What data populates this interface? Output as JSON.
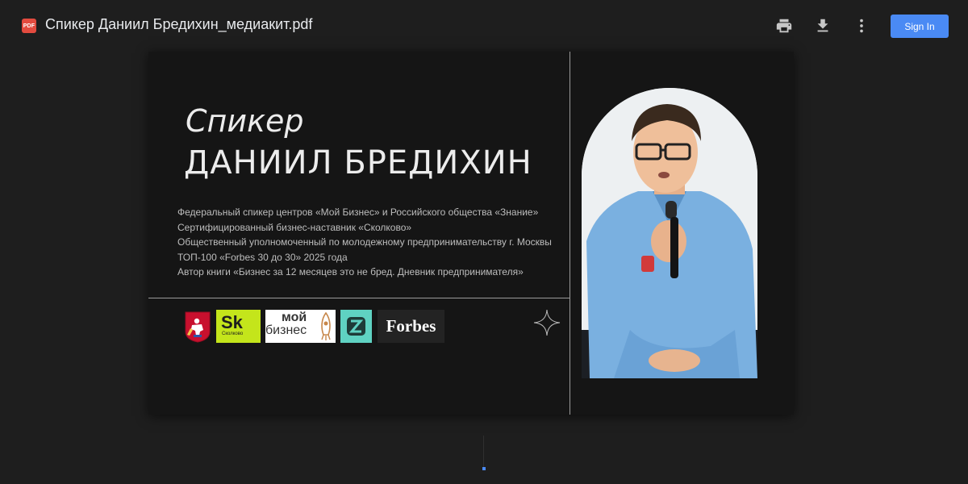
{
  "window": {
    "file_badge": "PDF",
    "title": "Спикер Даниил Бредихин_медиакит.pdf"
  },
  "toolbar": {
    "print_icon": "print-icon",
    "download_icon": "download-icon",
    "more_icon": "more-vert-icon",
    "signin_label": "Sign In",
    "accent": "#4a8af4"
  },
  "slide": {
    "kicker": "Спикер",
    "name": "ДАНИИЛ БРЕДИХИН",
    "bio": [
      "Федеральный спикер центров «Мой Бизнес» и Российского общества «Знание»",
      "Сертифицированный бизнес-наставник «Сколково»",
      "Общественный уполномоченный по молодежному предпринимательству г. Москвы",
      "ТОП-100 «Forbes 30 до 30» 2025 года",
      "Автор книги «Бизнес за 12 месяцев это не бред. Дневник предпринимателя»"
    ],
    "logos": {
      "sk": "Sk",
      "sk_name": "Сколково",
      "moi_line1": "мой",
      "moi_line2": "бизнес",
      "forbes": "Forbes"
    }
  }
}
